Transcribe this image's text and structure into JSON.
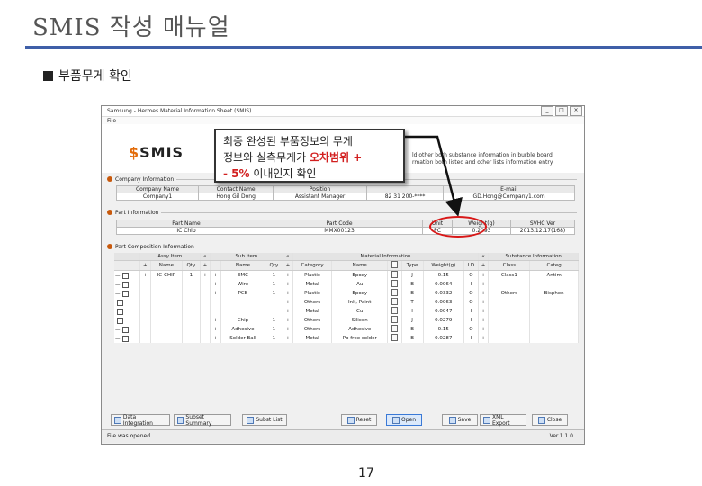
{
  "slide": {
    "title": "SMIS 작성 매뉴얼",
    "bullet": "부품무게 확인",
    "page_number": "17"
  },
  "window": {
    "title": "Samsung - Hermes Material Information Sheet (SMIS)",
    "menu": "File",
    "logo_text": "SMIS",
    "description_lines": [
      "ld other both substance information in burble board.",
      "rmation both listed and other lists information entry."
    ]
  },
  "company": {
    "section_label": "Company Information",
    "headers": [
      "Company Name",
      "Contact Name",
      "Position",
      "E-mail"
    ],
    "values": [
      "Company1",
      "Hong Gil Dong",
      "Assistant Manager",
      "82 31 200-****",
      "GD.Hong@Company1.com"
    ]
  },
  "part": {
    "section_label": "Part Information",
    "headers": [
      "Part Name",
      "Part Code",
      "Unit",
      "Weight(g)",
      "SVHC Ver"
    ],
    "values": [
      "IC Chip",
      "MMX00123",
      "PC",
      "0.2093",
      "2013.12.17(168)"
    ]
  },
  "composition": {
    "section_label": "Part Composition Information",
    "group_headers": [
      "Assy Item",
      "Sub Item",
      "Material Information",
      "Substance Information"
    ],
    "columns": [
      "Name",
      "Qty",
      "Name",
      "Qty",
      "Category",
      "Name",
      "Type",
      "Weight(g)",
      "LD",
      "Class",
      "Categ"
    ],
    "rows": [
      {
        "tree": "—",
        "assy": "IC-CHIP",
        "aqty": "1",
        "sub": "EMC",
        "sqty": "1",
        "cat": "Plastic",
        "name": "Epoxy",
        "type": "J",
        "weight": "0.15",
        "ld": "O",
        "cls": "Class1",
        "categ": "Antim"
      },
      {
        "tree": "—",
        "assy": "",
        "aqty": "",
        "sub": "Wire",
        "sqty": "1",
        "cat": "Metal",
        "name": "Au",
        "type": "B",
        "weight": "0.0064",
        "ld": "I",
        "cls": "",
        "categ": ""
      },
      {
        "tree": "—",
        "assy": "",
        "aqty": "",
        "sub": "PCB",
        "sqty": "1",
        "cat": "Plastic",
        "name": "Epoxy",
        "type": "B",
        "weight": "0.0332",
        "ld": "O",
        "cls": "Others",
        "categ": "Bisphen"
      },
      {
        "tree": "",
        "assy": "",
        "aqty": "",
        "sub": "",
        "sqty": "",
        "cat": "Others",
        "name": "Ink, Paint",
        "type": "T",
        "weight": "0.0063",
        "ld": "O",
        "cls": "",
        "categ": ""
      },
      {
        "tree": "",
        "assy": "",
        "aqty": "",
        "sub": "",
        "sqty": "",
        "cat": "Metal",
        "name": "Cu",
        "type": "I",
        "weight": "0.0047",
        "ld": "I",
        "cls": "",
        "categ": ""
      },
      {
        "tree": "",
        "assy": "",
        "aqty": "",
        "sub": "Chip",
        "sqty": "1",
        "cat": "Others",
        "name": "Silicon",
        "type": "J",
        "weight": "0.0279",
        "ld": "I",
        "cls": "",
        "categ": ""
      },
      {
        "tree": "—",
        "assy": "",
        "aqty": "",
        "sub": "Adhesive",
        "sqty": "1",
        "cat": "Others",
        "name": "Adhesive",
        "type": "B",
        "weight": "0.15",
        "ld": "O",
        "cls": "",
        "categ": ""
      },
      {
        "tree": "—",
        "assy": "",
        "aqty": "",
        "sub": "Solder Ball",
        "sqty": "1",
        "cat": "Metal",
        "name": "Pb free solder",
        "type": "B",
        "weight": "0.0287",
        "ld": "I",
        "cls": "",
        "categ": ""
      }
    ]
  },
  "buttons": {
    "data_integration": "Data Integration",
    "subset_summary": "Subset Summary",
    "subst_list": "Subst List",
    "reset": "Reset",
    "open": "Open",
    "save": "Save",
    "xml_export": "XML Export",
    "close": "Close"
  },
  "status": {
    "left": "File was opened.",
    "right": "Ver.1.1.0"
  },
  "callout": {
    "line1": "최종 완성된 부품정보의 무게",
    "line2_pre": "정보와 실측무게가 ",
    "line2_red": "오차범위 +",
    "line3_red": "- 5%",
    "line3_post": " 이내인지 확인"
  },
  "colors": {
    "title_rule": "#3f5fa8",
    "highlight_red": "#d81818",
    "logo_accent": "#e36c0a"
  }
}
